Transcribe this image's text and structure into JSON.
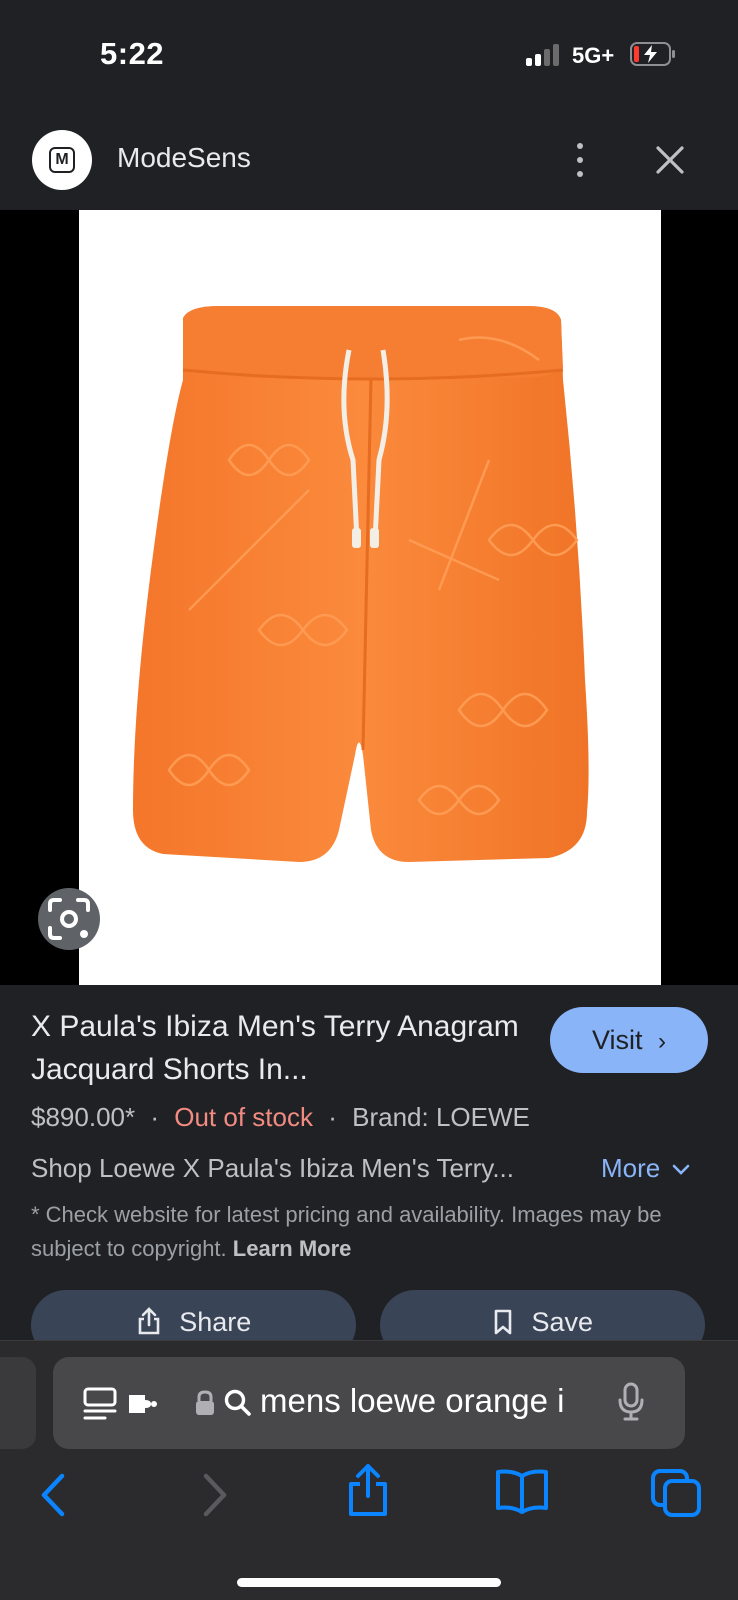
{
  "status": {
    "time": "5:22",
    "network": "5G+",
    "signal_icon": "cellular-signal-icon",
    "battery_icon": "battery-charging-icon",
    "battery_color": "#ff3b30"
  },
  "header": {
    "logo_letter": "M",
    "site_name": "ModeSens",
    "menu_icon": "more-vert-icon",
    "close_icon": "close-icon"
  },
  "image": {
    "lens_icon": "google-lens-icon"
  },
  "product": {
    "title": "X Paula's Ibiza Men's Terry Anagram Jacquard Shorts In...",
    "visit_label": "Visit",
    "price": "$890.00*",
    "separator": "·",
    "stock": "Out of stock",
    "brand": "Brand: LOEWE",
    "description": "Shop Loewe X Paula's Ibiza Men's Terry...",
    "more_label": "More",
    "disclaimer": "* Check website for latest pricing and availability. Images may be subject to copyright.",
    "learn_more": "Learn More",
    "share_label": "Share",
    "save_label": "Save"
  },
  "browser": {
    "url_text": "mens loewe orange i",
    "accent": "#0a84ff"
  }
}
